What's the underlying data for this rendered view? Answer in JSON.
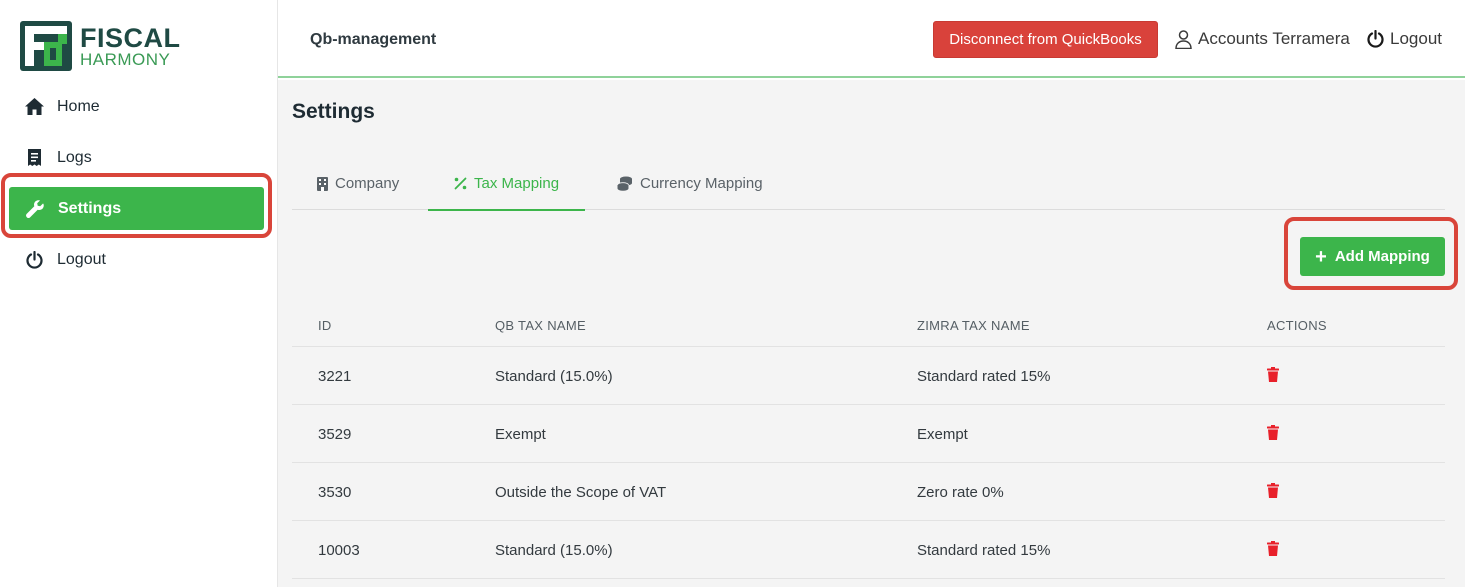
{
  "brand": {
    "line1": "FISCAL",
    "line2": "HARMONY",
    "green": "#3cb54b",
    "dark": "#1f4a44"
  },
  "sidebar": {
    "items": [
      {
        "label": "Home",
        "icon": "home-icon"
      },
      {
        "label": "Logs",
        "icon": "receipt-icon"
      },
      {
        "label": "Settings",
        "icon": "wrench-icon",
        "active": true
      },
      {
        "label": "Logout",
        "icon": "power-icon"
      }
    ]
  },
  "header": {
    "title": "Qb-management",
    "disconnect_label": "Disconnect from QuickBooks",
    "user_label": "Accounts Terramera",
    "logout_label": "Logout"
  },
  "page": {
    "title": "Settings",
    "tabs": [
      {
        "label": "Company",
        "icon": "building-icon"
      },
      {
        "label": "Tax Mapping",
        "icon": "percent-icon",
        "active": true
      },
      {
        "label": "Currency Mapping",
        "icon": "coins-icon"
      }
    ],
    "add_label": "Add Mapping"
  },
  "table": {
    "columns": [
      "ID",
      "QB TAX NAME",
      "ZIMRA TAX NAME",
      "ACTIONS"
    ],
    "rows": [
      {
        "id": "3221",
        "qb": "Standard (15.0%)",
        "zimra": "Standard rated 15%"
      },
      {
        "id": "3529",
        "qb": "Exempt",
        "zimra": "Exempt"
      },
      {
        "id": "3530",
        "qb": "Outside the Scope of VAT",
        "zimra": "Zero rate 0%"
      },
      {
        "id": "10003",
        "qb": "Standard (15.0%)",
        "zimra": "Standard rated 15%"
      }
    ]
  },
  "colors": {
    "danger": "#d9423b",
    "delete_icon": "#e8202a",
    "highlight": "#d9453a"
  }
}
